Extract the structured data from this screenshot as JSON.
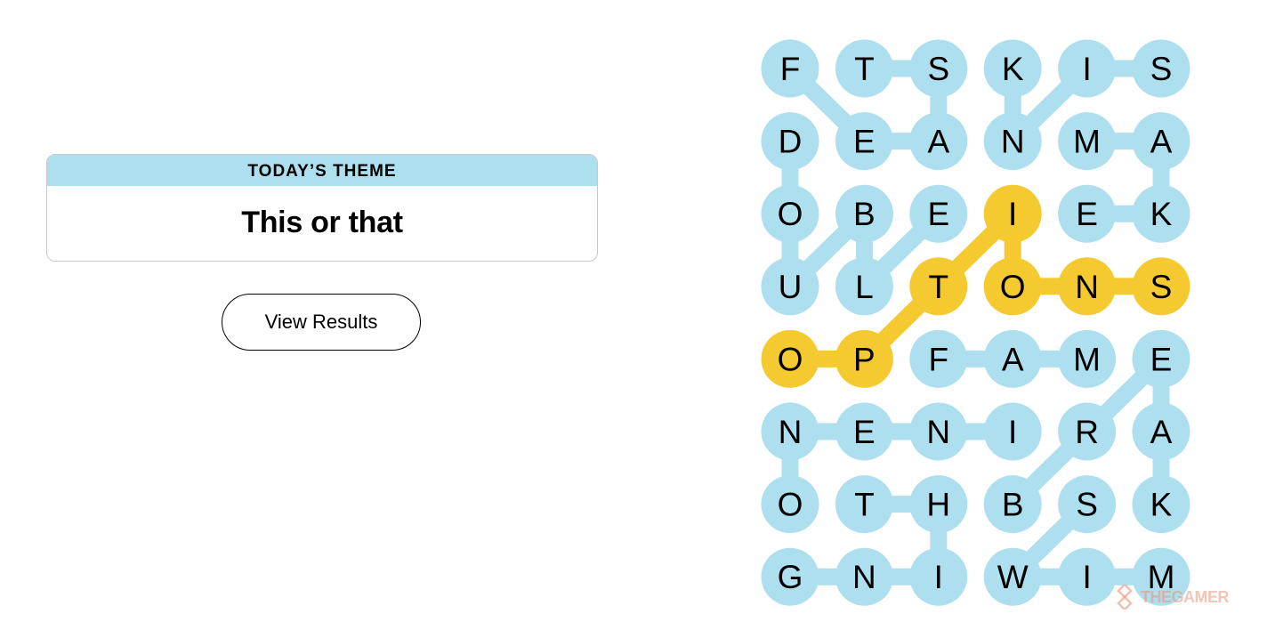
{
  "theme": {
    "header": "TODAY’S THEME",
    "title": "This or that"
  },
  "view_results_label": "View Results",
  "colors": {
    "tile": "#aedfee",
    "spangram": "#f5c930",
    "card_header": "#aedfee"
  },
  "board": {
    "rows": [
      [
        "F",
        "T",
        "S",
        "K",
        "I",
        "S"
      ],
      [
        "D",
        "E",
        "A",
        "N",
        "M",
        "A"
      ],
      [
        "O",
        "B",
        "E",
        "I",
        "E",
        "K"
      ],
      [
        "U",
        "L",
        "T",
        "O",
        "N",
        "S"
      ],
      [
        "O",
        "P",
        "F",
        "A",
        "M",
        "E"
      ],
      [
        "N",
        "E",
        "N",
        "I",
        "R",
        "A"
      ],
      [
        "O",
        "T",
        "H",
        "B",
        "S",
        "K"
      ],
      [
        "G",
        "N",
        "I",
        "W",
        "I",
        "M"
      ]
    ],
    "spangram_cells": [
      [
        4,
        0
      ],
      [
        4,
        1
      ],
      [
        3,
        2
      ],
      [
        2,
        3
      ],
      [
        3,
        3
      ],
      [
        3,
        4
      ],
      [
        3,
        5
      ]
    ],
    "found_words": [
      {
        "path": [
          [
            4,
            0
          ],
          [
            4,
            1
          ],
          [
            3,
            2
          ],
          [
            2,
            3
          ],
          [
            3,
            3
          ],
          [
            3,
            4
          ],
          [
            3,
            5
          ]
        ],
        "color": "spangram"
      },
      {
        "path": [
          [
            0,
            0
          ],
          [
            1,
            1
          ],
          [
            1,
            2
          ],
          [
            0,
            2
          ],
          [
            0,
            1
          ]
        ],
        "color": "tile"
      },
      {
        "path": [
          [
            0,
            3
          ],
          [
            1,
            3
          ],
          [
            0,
            4
          ],
          [
            0,
            5
          ]
        ],
        "color": "tile"
      },
      {
        "path": [
          [
            1,
            4
          ],
          [
            1,
            5
          ],
          [
            2,
            5
          ],
          [
            2,
            4
          ]
        ],
        "color": "tile"
      },
      {
        "path": [
          [
            1,
            0
          ],
          [
            2,
            0
          ],
          [
            3,
            0
          ],
          [
            2,
            1
          ],
          [
            3,
            1
          ],
          [
            2,
            2
          ]
        ],
        "color": "tile"
      },
      {
        "path": [
          [
            4,
            2
          ],
          [
            4,
            3
          ],
          [
            4,
            4
          ]
        ],
        "color": "tile"
      },
      {
        "path": [
          [
            4,
            5
          ],
          [
            5,
            4
          ],
          [
            6,
            3
          ]
        ],
        "color": "tile"
      },
      {
        "path": [
          [
            4,
            5
          ],
          [
            5,
            5
          ],
          [
            6,
            5
          ]
        ],
        "color": "tile"
      },
      {
        "path": [
          [
            5,
            0
          ],
          [
            5,
            1
          ],
          [
            5,
            2
          ],
          [
            5,
            3
          ]
        ],
        "color": "tile"
      },
      {
        "path": [
          [
            5,
            0
          ],
          [
            6,
            0
          ]
        ],
        "color": "tile"
      },
      {
        "path": [
          [
            6,
            1
          ],
          [
            6,
            2
          ],
          [
            7,
            2
          ],
          [
            7,
            1
          ],
          [
            7,
            0
          ]
        ],
        "color": "tile"
      },
      {
        "path": [
          [
            6,
            4
          ],
          [
            7,
            3
          ],
          [
            7,
            4
          ],
          [
            7,
            5
          ]
        ],
        "color": "tile"
      }
    ]
  },
  "watermark": "THEGAMER"
}
